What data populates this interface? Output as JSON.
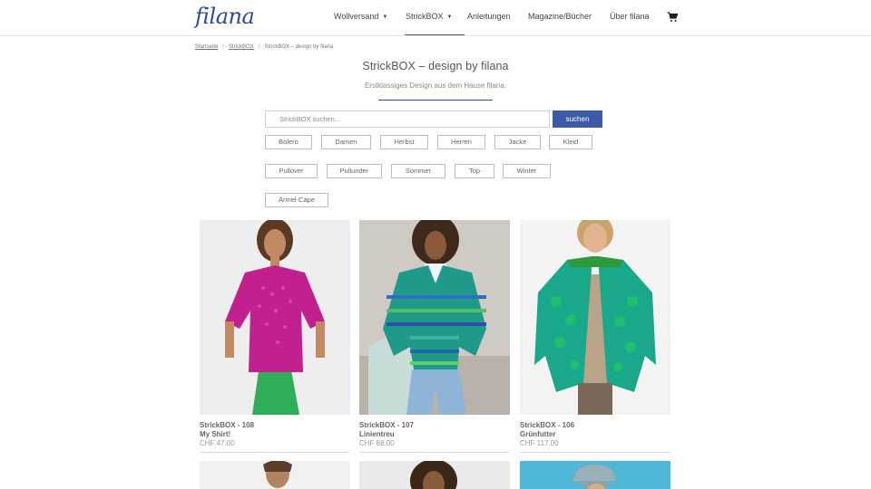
{
  "header": {
    "logo": "filana",
    "nav": [
      {
        "label": "Wollversand",
        "has_caret": true
      },
      {
        "label": "StrickBOX",
        "has_caret": true,
        "active": true
      },
      {
        "label": "Anleitungen",
        "has_caret": false
      },
      {
        "label": "Magazine/Bücher",
        "has_caret": false
      },
      {
        "label": "Über filana",
        "has_caret": false
      }
    ],
    "cart_icon": "shopping-cart-icon",
    "caret_glyph": "▼"
  },
  "breadcrumb": {
    "items": [
      "Startseite",
      "StrickBOX",
      "StrickBOX – design by filana"
    ],
    "separator": "/"
  },
  "page": {
    "title": "StrickBOX – design by filana",
    "subtitle": "Erstklassiges Design aus dem Hause filana.",
    "accent_color": "#2e4b9b"
  },
  "search": {
    "placeholder": "StrickBOX suchen...",
    "value": "",
    "button_label": "suchen",
    "button_color": "#3d5aa8"
  },
  "tags": [
    "Bolero",
    "Damen",
    "Herbst",
    "Herren",
    "Jacke",
    "Kleid",
    "Pullover",
    "Pullunder",
    "Sommer",
    "Top",
    "Winter",
    "Ärmel-Cape"
  ],
  "products": [
    {
      "name": "StrickBOX - 108",
      "subtitle": "My Shirt!",
      "price": "CHF 47.00",
      "garment_color": "#c21f8f"
    },
    {
      "name": "StrickBOX - 107",
      "subtitle": "Linientreu",
      "price": "CHF 88.00",
      "garment_color": "#1f9a8a"
    },
    {
      "name": "StrickBOX - 106",
      "subtitle": "Grünfutter",
      "price": "CHF 117.00",
      "garment_color": "#1aa88a"
    }
  ]
}
